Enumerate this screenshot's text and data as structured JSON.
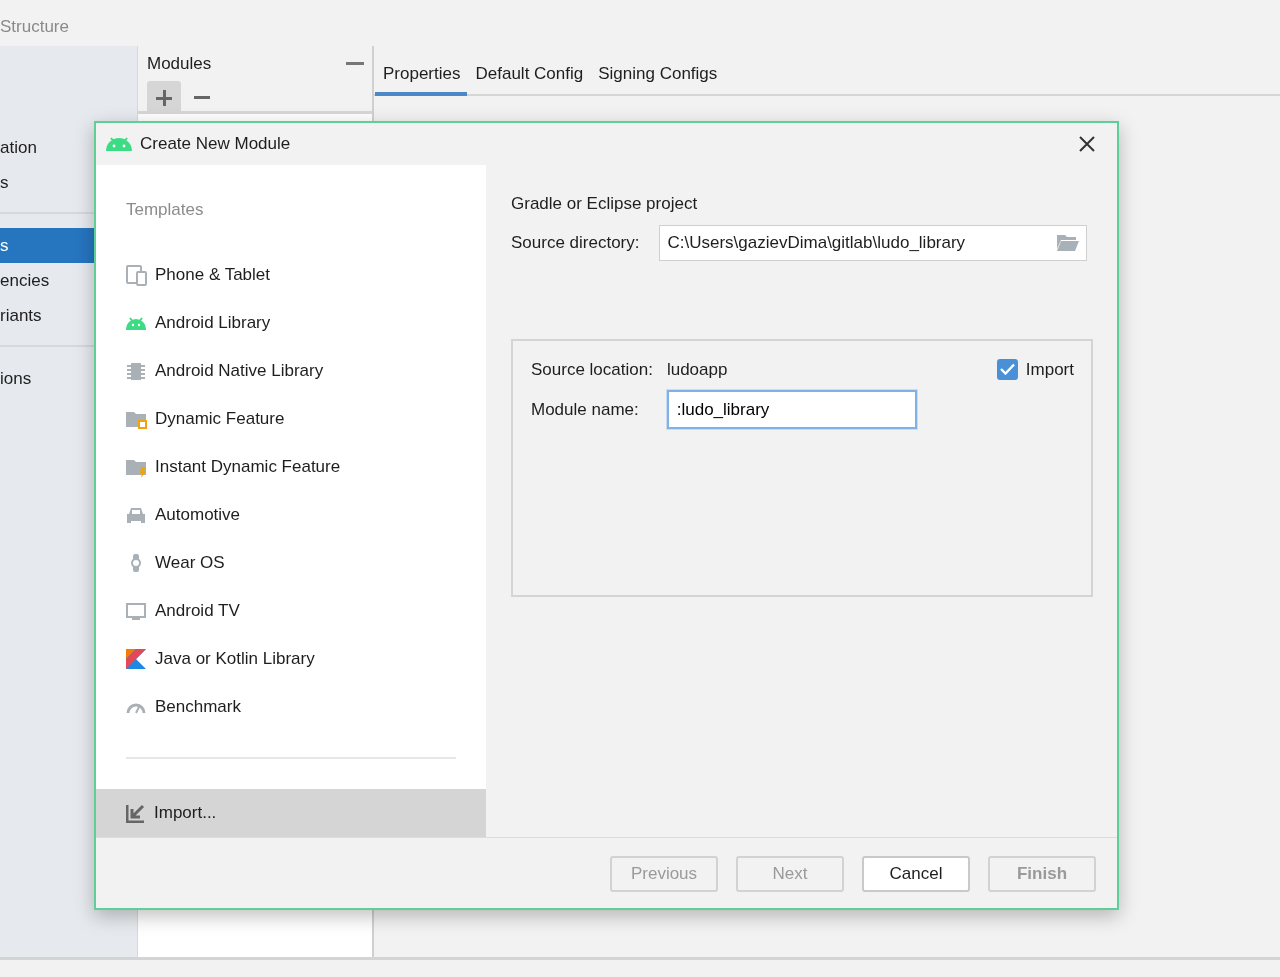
{
  "background": {
    "title": "Structure",
    "sidebar_groups": [
      [
        {
          "label": "ation",
          "selected": false
        },
        {
          "label": "s",
          "selected": false
        }
      ],
      [
        {
          "label": "s",
          "selected": true
        },
        {
          "label": "encies",
          "selected": false
        },
        {
          "label": "riants",
          "selected": false
        }
      ],
      [
        {
          "label": "ions",
          "selected": false
        }
      ]
    ],
    "modules_title": "Modules",
    "tabs": [
      {
        "label": "Properties",
        "selected": true
      },
      {
        "label": "Default Config",
        "selected": false
      },
      {
        "label": "Signing Configs",
        "selected": false
      }
    ]
  },
  "dialog": {
    "title": "Create New Module",
    "templates_heading": "Templates",
    "templates": [
      {
        "label": "Phone & Tablet",
        "selected": false
      },
      {
        "label": "Android Library",
        "selected": false
      },
      {
        "label": "Android Native Library",
        "selected": false
      },
      {
        "label": "Dynamic Feature",
        "selected": false
      },
      {
        "label": "Instant Dynamic Feature",
        "selected": false
      },
      {
        "label": "Automotive",
        "selected": false
      },
      {
        "label": "Wear OS",
        "selected": false
      },
      {
        "label": "Android TV",
        "selected": false
      },
      {
        "label": "Java or Kotlin Library",
        "selected": false
      },
      {
        "label": "Benchmark",
        "selected": false
      }
    ],
    "import_item": {
      "label": "Import...",
      "selected": true
    },
    "section_title": "Gradle or Eclipse project",
    "source_directory": {
      "label": "Source directory:",
      "value": "C:\\Users\\gazievDima\\gitlab\\ludo_library"
    },
    "source_location": {
      "label": "Source location:",
      "value": "ludoapp"
    },
    "import_checkbox": {
      "label": "Import",
      "checked": true
    },
    "module_name": {
      "label": "Module name:",
      "value": ":ludo_library"
    },
    "buttons": [
      {
        "label": "Previous",
        "disabled": true,
        "default": false
      },
      {
        "label": "Next",
        "disabled": true,
        "default": false
      },
      {
        "label": "Cancel",
        "disabled": false,
        "default": false
      },
      {
        "label": "Finish",
        "disabled": true,
        "default": true
      }
    ]
  }
}
